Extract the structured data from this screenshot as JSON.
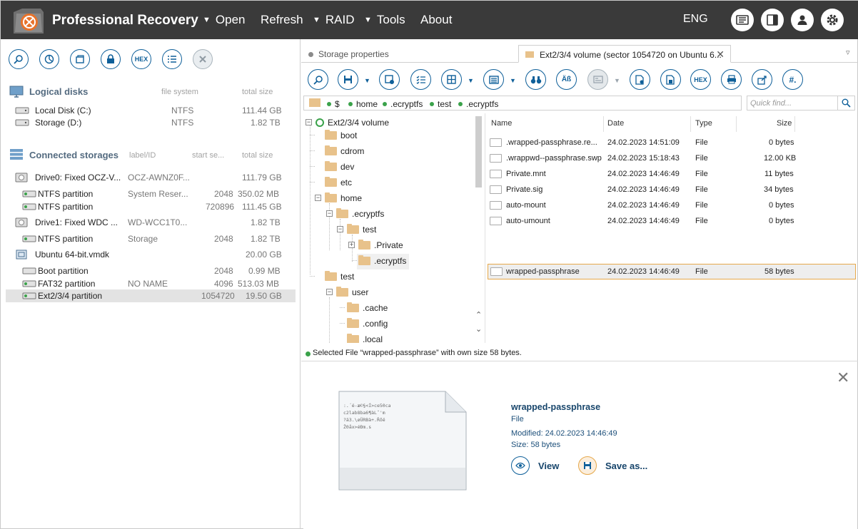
{
  "app": {
    "title": "Professional Recovery",
    "language": "ENG"
  },
  "menu": [
    {
      "label": "Open",
      "dropdown": true
    },
    {
      "label": "Refresh",
      "dropdown": false
    },
    {
      "label": "RAID",
      "dropdown": true
    },
    {
      "label": "Tools",
      "dropdown": true
    },
    {
      "label": "About",
      "dropdown": false
    }
  ],
  "toolbar_icons": [
    "news-icon",
    "panel-icon",
    "user-icon",
    "settings-gear-icon"
  ],
  "left_toolbar": [
    "scan-icon",
    "chart-icon",
    "image-icon",
    "lock-icon",
    "HEX",
    "list-icon",
    "close-icon"
  ],
  "logical": {
    "title": "Logical disks",
    "col_fs": "file system",
    "col_size": "total size",
    "items": [
      {
        "name": "Local Disk (C:)",
        "fs": "NTFS",
        "size": "111.44 GB"
      },
      {
        "name": "Storage (D:)",
        "fs": "NTFS",
        "size": "1.82 TB"
      }
    ]
  },
  "storages": {
    "title": "Connected storages",
    "col_label": "label/ID",
    "col_start": "start se...",
    "col_size": "total size",
    "items": [
      {
        "name": "Drive0: Fixed OCZ-V...",
        "label": "OCZ-AWNZ0F...",
        "start": "",
        "size": "111.79 GB",
        "level": 0
      },
      {
        "name": "NTFS partition",
        "label": "System Reser...",
        "start": "2048",
        "size": "350.02 MB",
        "level": 1
      },
      {
        "name": "NTFS partition",
        "label": "",
        "start": "720896",
        "size": "111.45 GB",
        "level": 1
      },
      {
        "name": "Drive1: Fixed WDC ...",
        "label": "WD-WCC1T0...",
        "start": "",
        "size": "1.82 TB",
        "level": 0
      },
      {
        "name": "NTFS partition",
        "label": "Storage",
        "start": "2048",
        "size": "1.82 TB",
        "level": 1
      },
      {
        "name": "Ubuntu 64-bit.vmdk",
        "label": "",
        "start": "",
        "size": "20.00 GB",
        "level": 0
      },
      {
        "name": "Boot partition",
        "label": "",
        "start": "2048",
        "size": "0.99 MB",
        "level": 1
      },
      {
        "name": "FAT32 partition",
        "label": "NO NAME",
        "start": "4096",
        "size": "513.03 MB",
        "level": 1
      },
      {
        "name": "Ext2/3/4 partition",
        "label": "",
        "start": "1054720",
        "size": "19.50 GB",
        "level": 1
      }
    ]
  },
  "tabs": [
    {
      "label": "Storage properties",
      "active": false
    },
    {
      "label": "Ext2/3/4 volume (sector 1054720 on Ubuntu 6...",
      "active": true
    }
  ],
  "path": [
    "$",
    "home",
    ".ecryptfs",
    "test",
    ".ecryptfs"
  ],
  "find_placeholder": "Quick find...",
  "tree": [
    {
      "label": "Ext2/3/4 volume",
      "depth": 0,
      "exp": "-"
    },
    {
      "label": "boot",
      "depth": 1,
      "exp": ""
    },
    {
      "label": "cdrom",
      "depth": 1,
      "exp": ""
    },
    {
      "label": "dev",
      "depth": 1,
      "exp": ""
    },
    {
      "label": "etc",
      "depth": 1,
      "exp": ""
    },
    {
      "label": "home",
      "depth": 1,
      "exp": "-"
    },
    {
      "label": ".ecryptfs",
      "depth": 2,
      "exp": "-"
    },
    {
      "label": "test",
      "depth": 3,
      "exp": "-"
    },
    {
      "label": ".Private",
      "depth": 4,
      "exp": "+"
    },
    {
      "label": ".ecryptfs",
      "depth": 4,
      "exp": "",
      "sel": true
    },
    {
      "label": "test",
      "depth": 1,
      "exp": ""
    },
    {
      "label": "user",
      "depth": 1,
      "exp": "-"
    },
    {
      "label": ".cache",
      "depth": 2,
      "exp": ""
    },
    {
      "label": ".config",
      "depth": 2,
      "exp": ""
    },
    {
      "label": ".local",
      "depth": 2,
      "exp": ""
    }
  ],
  "list": {
    "cols": [
      "Name",
      "Date",
      "Type",
      "Size"
    ],
    "rows": [
      {
        "name": ".wrapped-passphrase.re...",
        "date": "24.02.2023 14:51:09",
        "type": "File",
        "size": "0 bytes"
      },
      {
        "name": ".wrappwd--passphrase.swp",
        "date": "24.02.2023 15:18:43",
        "type": "File",
        "size": "12.00 KB"
      },
      {
        "name": "Private.mnt",
        "date": "24.02.2023 14:46:49",
        "type": "File",
        "size": "11 bytes"
      },
      {
        "name": "Private.sig",
        "date": "24.02.2023 14:46:49",
        "type": "File",
        "size": "34 bytes"
      },
      {
        "name": "auto-mount",
        "date": "24.02.2023 14:46:49",
        "type": "File",
        "size": "0 bytes"
      },
      {
        "name": "auto-umount",
        "date": "24.02.2023 14:46:49",
        "type": "File",
        "size": "0 bytes"
      },
      {
        "name": "wrapped-passphrase",
        "date": "24.02.2023 14:46:49",
        "type": "File",
        "size": "58 bytes",
        "sel": true
      }
    ]
  },
  "status": "Selected File “wrapped-passphrase” with own size 58 bytes.",
  "preview": {
    "name": "wrapped-passphrase",
    "type": "File",
    "modified": "Modified: 24.02.2023 14:46:49",
    "size": "Size: 58 bytes",
    "content": ":.´é-æ©§<Í>ce50ca\nc2lab8ba6¶àLˆ'm\n?ä3.\\øÜRBà+.Řõë\nŽ0åx>éÐm.s",
    "view_label": "View",
    "save_label": "Save as..."
  },
  "colors": {
    "accent": "#0e5f99",
    "topbar": "#3a3a3a",
    "selection_border": "#e6a84a",
    "status_ok": "#3aa24a"
  }
}
